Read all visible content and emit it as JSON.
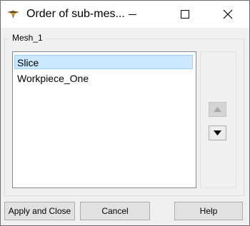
{
  "window": {
    "title": "Order of sub-mes..."
  },
  "group": {
    "label": "Mesh_1"
  },
  "list": {
    "items": [
      {
        "label": "Slice",
        "selected": true
      },
      {
        "label": "Workpiece_One",
        "selected": false
      }
    ]
  },
  "arrows": {
    "up_icon": "triangle-up-icon",
    "down_icon": "triangle-down-icon"
  },
  "buttons": {
    "apply_close": "Apply and Close",
    "cancel": "Cancel",
    "help": "Help"
  },
  "colors": {
    "selection_bg": "#cce8ff",
    "selection_border": "#99d1ff",
    "dialog_bg": "#f0f0f0"
  }
}
